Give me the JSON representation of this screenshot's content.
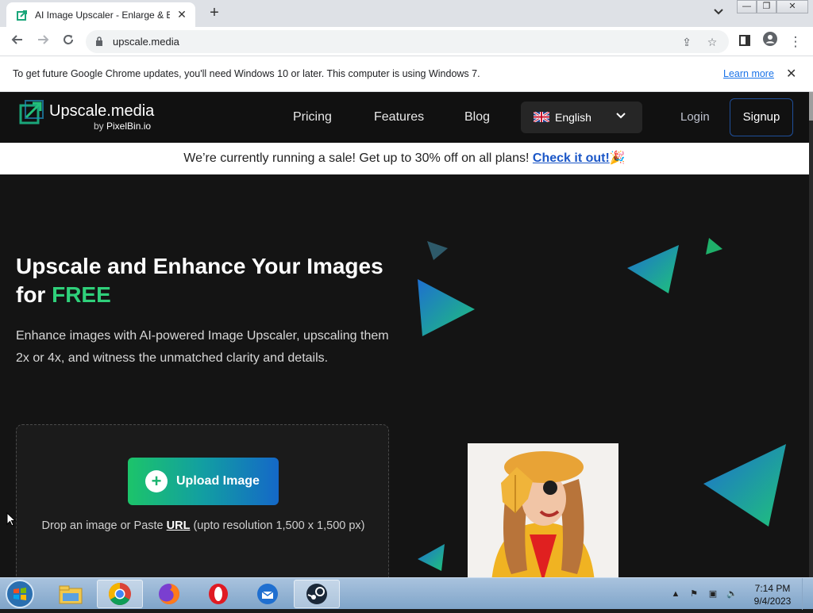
{
  "browser": {
    "tab_title": "AI Image Upscaler - Enlarge & En",
    "tab_close": "✕",
    "new_tab": "+",
    "tab_search_icon": "chevron-down-icon",
    "window_controls": [
      "—",
      "❐",
      "✕"
    ],
    "url": "upscale.media",
    "nav_icons": [
      "back-arrow-icon",
      "forward-arrow-icon",
      "reload-icon"
    ]
  },
  "infobar": {
    "message": "To get future Google Chrome updates, you'll need Windows 10 or later. This computer is using Windows 7.",
    "link": "Learn more",
    "close": "✕"
  },
  "header": {
    "logo_name": "Upscale.media",
    "logo_by": "by ",
    "logo_by_brand": "PixelBin.io",
    "nav": {
      "pricing": "Pricing",
      "features": "Features",
      "blog": "Blog"
    },
    "language": "English",
    "login": "Login",
    "signup": "Signup"
  },
  "sale_banner": {
    "text": "We’re currently running a sale! Get up to 30% off on all plans! ",
    "link": "Check it out!",
    "emoji": "🎉"
  },
  "hero": {
    "title_line1": "Upscale and Enhance Your Images",
    "title_for": "for ",
    "title_free": "FREE",
    "description": "Enhance images with AI-powered Image Upscaler, upscaling them 2x or 4x, and witness the unmatched clarity and details.",
    "upload_button": "Upload Image",
    "drop_prefix": "Drop an image or Paste ",
    "drop_url": "URL",
    "drop_suffix": " (upto resolution 1,500 x 1,500 px)"
  },
  "taskbar": {
    "apps": [
      "file-explorer-icon",
      "chrome-icon",
      "firefox-icon",
      "opera-icon",
      "thunderbird-icon",
      "steam-icon"
    ],
    "time": "7:14 PM",
    "date": "9/4/2023"
  },
  "colors": {
    "accent_green": "#2fd07a",
    "link_blue": "#1a56c7",
    "header_bg": "#111111"
  }
}
